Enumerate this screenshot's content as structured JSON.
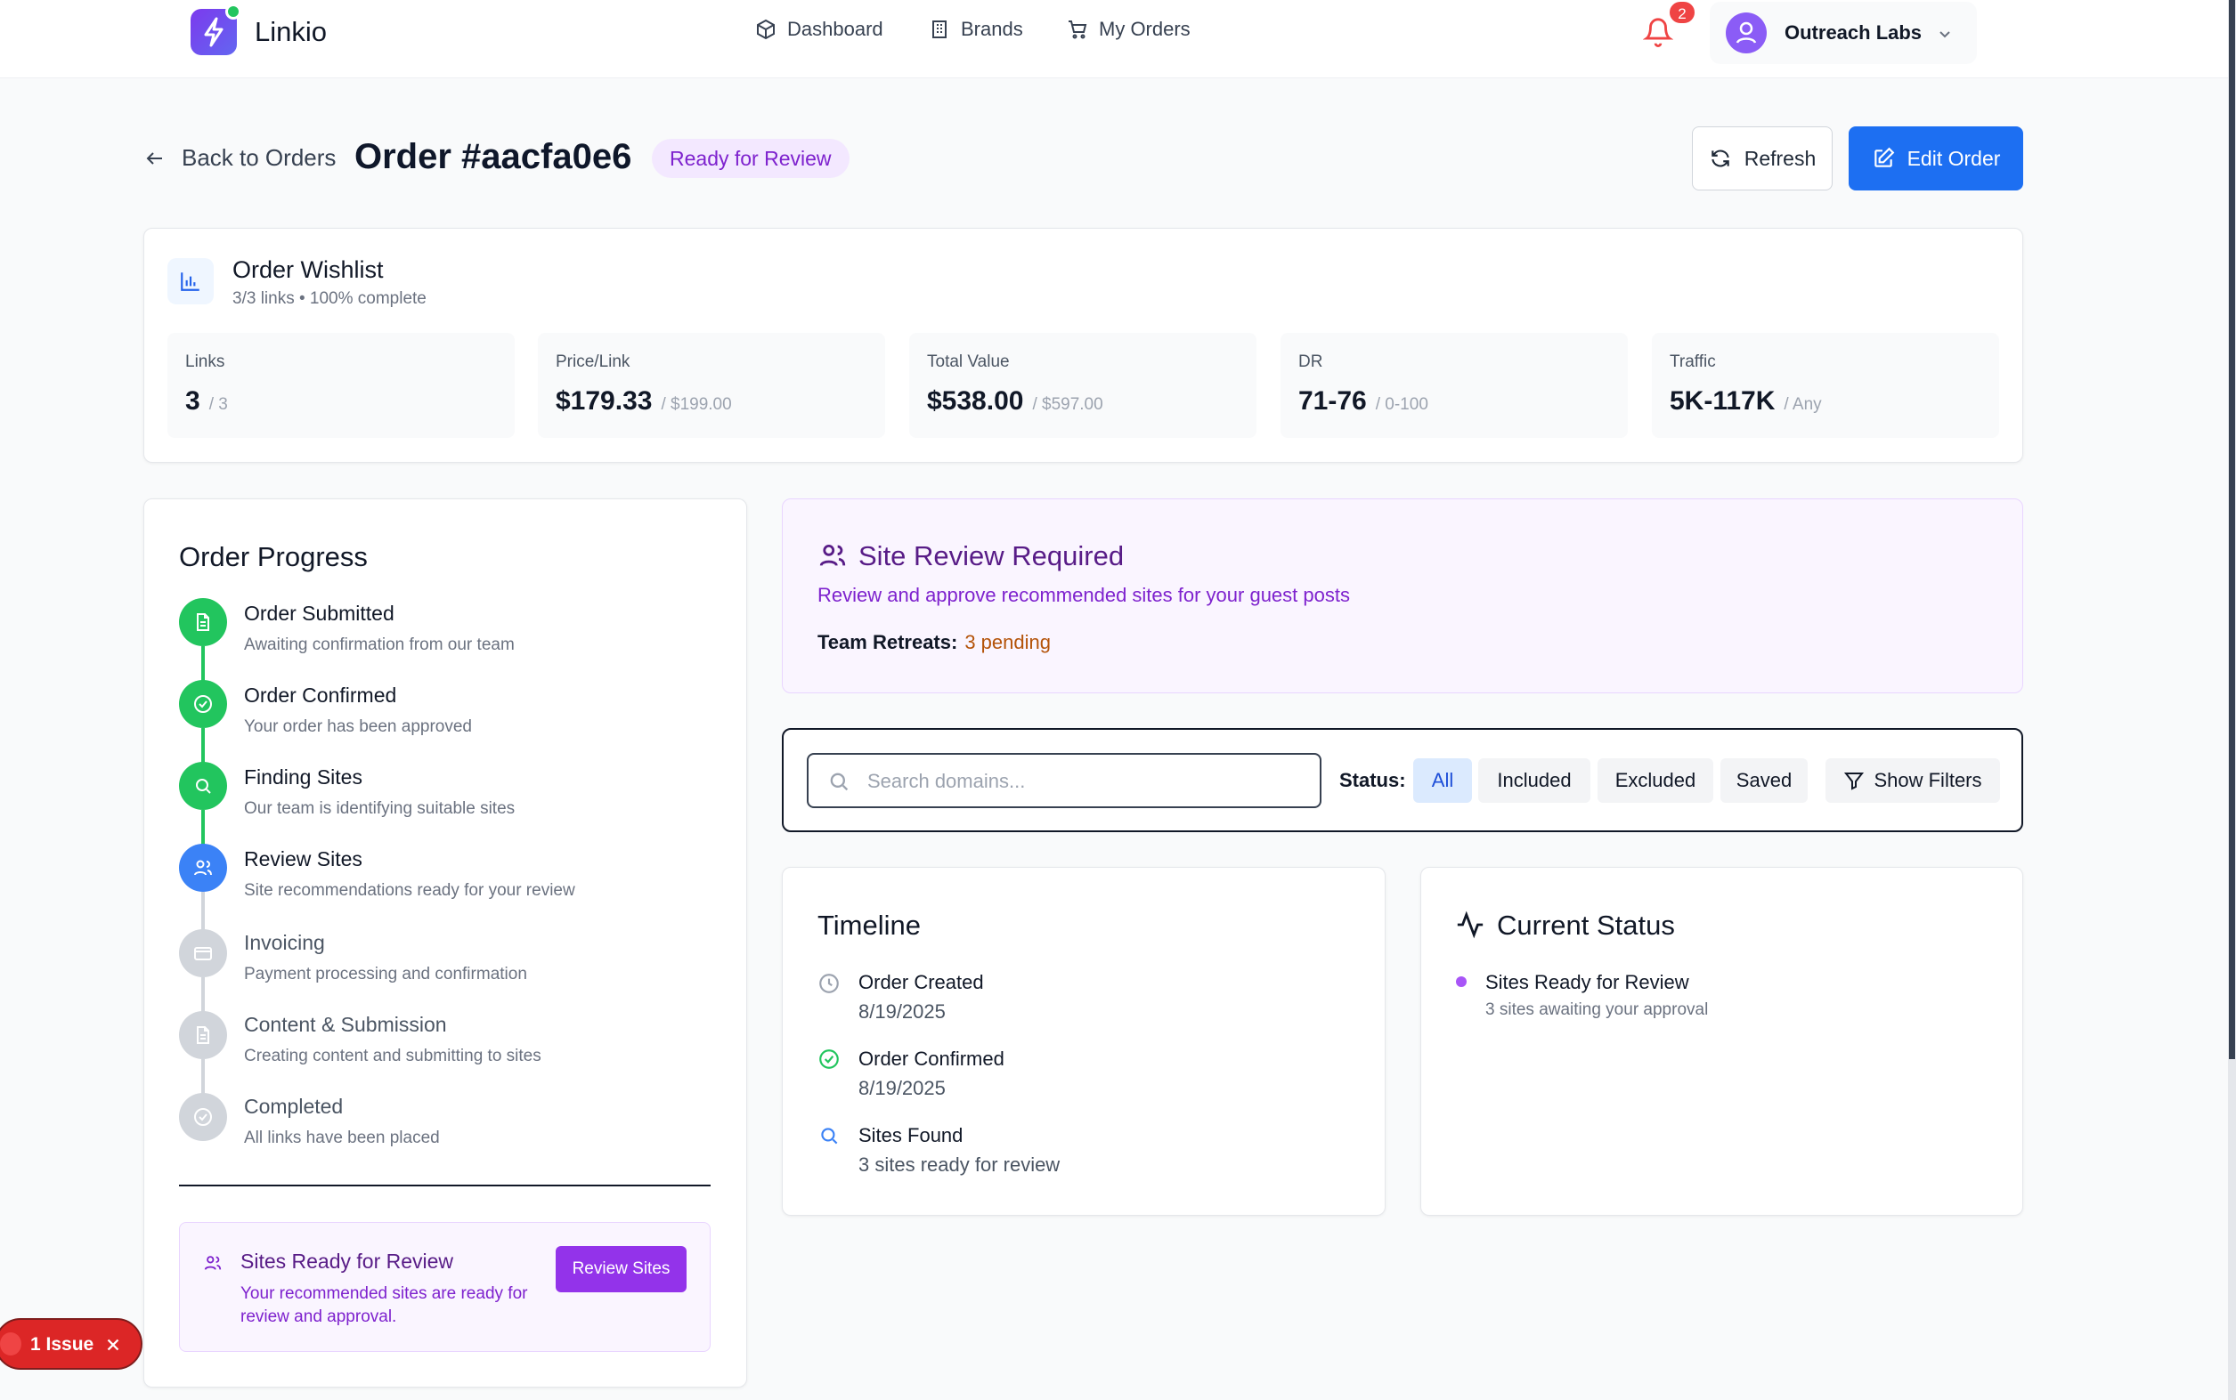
{
  "header": {
    "brand": "Linkio",
    "nav": [
      {
        "label": "Dashboard",
        "icon": "package-icon"
      },
      {
        "label": "Brands",
        "icon": "building-icon"
      },
      {
        "label": "My Orders",
        "icon": "cart-icon"
      }
    ],
    "notifications_count": "2",
    "account_name": "Outreach Labs"
  },
  "page": {
    "back_label": "Back to Orders",
    "title": "Order #aacfa0e6",
    "status": "Ready for Review",
    "refresh_label": "Refresh",
    "edit_label": "Edit Order"
  },
  "wishlist": {
    "title": "Order Wishlist",
    "subtitle": "3/3 links • 100% complete",
    "stats": [
      {
        "label": "Links",
        "value": "3",
        "sub": "/ 3"
      },
      {
        "label": "Price/Link",
        "value": "$179.33",
        "sub": "/ $199.00"
      },
      {
        "label": "Total Value",
        "value": "$538.00",
        "sub": "/ $597.00"
      },
      {
        "label": "DR",
        "value": "71-76",
        "sub": "/ 0-100"
      },
      {
        "label": "Traffic",
        "value": "5K-117K",
        "sub": "/ Any"
      }
    ]
  },
  "progress": {
    "title": "Order Progress",
    "steps": [
      {
        "title": "Order Submitted",
        "desc": "Awaiting confirmation from our team",
        "state": "done"
      },
      {
        "title": "Order Confirmed",
        "desc": "Your order has been approved",
        "state": "done"
      },
      {
        "title": "Finding Sites",
        "desc": "Our team is identifying suitable sites",
        "state": "done"
      },
      {
        "title": "Review Sites",
        "desc": "Site recommendations ready for your review",
        "state": "current"
      },
      {
        "title": "Invoicing",
        "desc": "Payment processing and confirmation",
        "state": "pending"
      },
      {
        "title": "Content & Submission",
        "desc": "Creating content and submitting to sites",
        "state": "pending"
      },
      {
        "title": "Completed",
        "desc": "All links have been placed",
        "state": "pending"
      }
    ],
    "callout": {
      "title": "Sites Ready for Review",
      "desc": "Your recommended sites are ready for review and approval.",
      "button": "Review Sites"
    }
  },
  "site_review": {
    "title": "Site Review Required",
    "desc": "Review and approve recommended sites for your guest posts",
    "team_label": "Team Retreats:",
    "team_pending": "3 pending"
  },
  "filters": {
    "search_placeholder": "Search domains...",
    "status_label": "Status:",
    "chips": [
      "All",
      "Included",
      "Excluded",
      "Saved"
    ],
    "show_filters": "Show Filters"
  },
  "timeline": {
    "title": "Timeline",
    "items": [
      {
        "title": "Order Created",
        "date": "8/19/2025"
      },
      {
        "title": "Order Confirmed",
        "date": "8/19/2025"
      },
      {
        "title": "Sites Found",
        "date": "3 sites ready for review"
      }
    ]
  },
  "current_status": {
    "title": "Current Status",
    "item_title": "Sites Ready for Review",
    "item_desc": "3 sites awaiting your approval"
  },
  "issue_toast": {
    "label": "1 Issue"
  },
  "colors": {
    "primary": "#1d6ff2",
    "purple": "#9333ea",
    "green": "#22c55e"
  }
}
